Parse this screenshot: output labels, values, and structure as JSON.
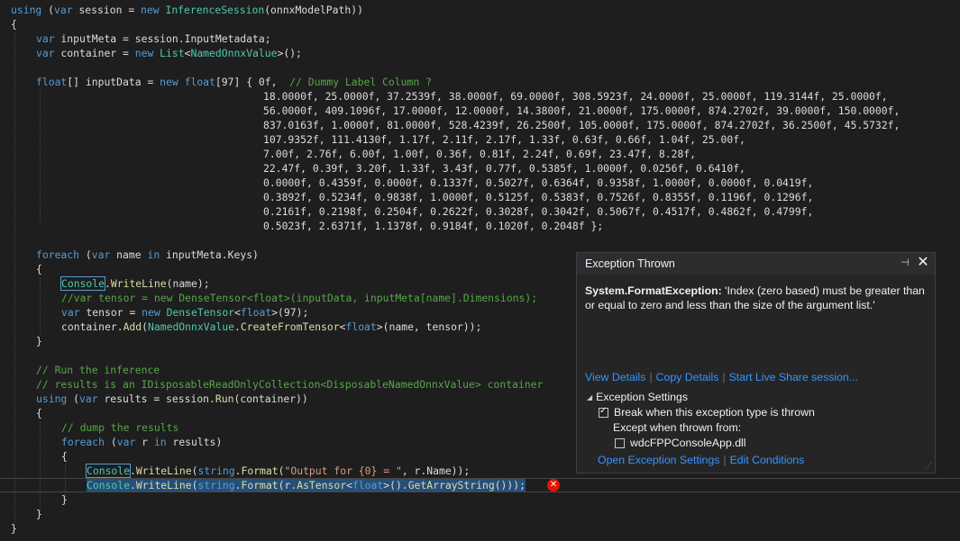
{
  "code": {
    "l1_kw": "using",
    "l1_a": " (",
    "l1_kw2": "var",
    "l1_b": " session = ",
    "l1_kw3": "new",
    "l1_ty": "InferenceSession",
    "l1_c": "(onnxModelPath))",
    "l2": "{",
    "l3_kw": "var",
    "l3_a": " inputMeta = session.InputMetadata;",
    "l4_kw": "var",
    "l4_a": " container = ",
    "l4_kw2": "new",
    "l4_ty": "List",
    "l4_b": "<",
    "l4_ty2": "NamedOnnxValue",
    "l4_c": ">();",
    "l5_kw": "float",
    "l5_a": "[] inputData = ",
    "l5_kw2": "new",
    "l5_kw3": "float",
    "l5_b": "[97] { 0f,  ",
    "l5_cm": "// Dummy Label Column ?",
    "data_lines": [
      "18.0000f, 25.0000f, 37.2539f, 38.0000f, 69.0000f, 308.5923f, 24.0000f, 25.0000f, 119.3144f, 25.0000f,",
      "56.0000f, 409.1096f, 17.0000f, 12.0000f, 14.3800f, 21.0000f, 175.0000f, 874.2702f, 39.0000f, 150.0000f,",
      "837.0163f, 1.0000f, 81.0000f, 528.4239f, 26.2500f, 105.0000f, 175.0000f, 874.2702f, 36.2500f, 45.5732f,",
      "107.9352f, 111.4130f, 1.17f, 2.11f, 2.17f, 1.33f, 0.63f, 0.66f, 1.04f, 25.00f,",
      "7.00f, 2.76f, 6.00f, 1.00f, 0.36f, 0.81f, 2.24f, 0.69f, 23.47f, 8.28f,",
      "22.47f, 0.39f, 3.20f, 1.33f, 3.43f, 0.77f, 0.5385f, 1.0000f, 0.0256f, 0.6410f,",
      "0.0000f, 0.4359f, 0.0000f, 0.1337f, 0.5027f, 0.6364f, 0.9358f, 1.0000f, 0.0000f, 0.0419f,",
      "0.3892f, 0.5234f, 0.9838f, 1.0000f, 0.5125f, 0.5383f, 0.7526f, 0.8355f, 0.1196f, 0.1296f,",
      "0.2161f, 0.2198f, 0.2504f, 0.2622f, 0.3028f, 0.3042f, 0.5067f, 0.4517f, 0.4862f, 0.4799f,",
      "0.5023f, 2.6371f, 1.1378f, 0.9184f, 0.1020f, 0.2048f };"
    ],
    "l17_kw": "foreach",
    "l17_a": " (",
    "l17_kw2": "var",
    "l17_b": " name ",
    "l17_kw3": "in",
    "l17_c": " inputMeta.Keys)",
    "l18": "{",
    "l19_ty": "Console",
    "l19_a": ".",
    "l19_fn": "WriteLine",
    "l19_b": "(name);",
    "l20_cm": "//var tensor = new DenseTensor<float>(inputData, inputMeta[name].Dimensions);",
    "l21_kw": "var",
    "l21_a": " tensor = ",
    "l21_kw2": "new",
    "l21_ty": "DenseTensor",
    "l21_b": "<",
    "l21_kw3": "float",
    "l21_c": ">(97);",
    "l22_a": "container.",
    "l22_fn": "Add",
    "l22_b": "(",
    "l22_ty": "NamedOnnxValue",
    "l22_c": ".",
    "l22_fn2": "CreateFromTensor",
    "l22_d": "<",
    "l22_kw": "float",
    "l22_e": ">(name, tensor));",
    "l23": "}",
    "l25_cm": "// Run the inference",
    "l26_cm": "// results is an IDisposableReadOnlyCollection<DisposableNamedOnnxValue> container",
    "l27_kw": "using",
    "l27_a": " (",
    "l27_kw2": "var",
    "l27_b": " results = session.",
    "l27_fn": "Run",
    "l27_c": "(container))",
    "l28": "{",
    "l29_cm": "// dump the results",
    "l30_kw": "foreach",
    "l30_a": " (",
    "l30_kw2": "var",
    "l30_b": " r ",
    "l30_kw3": "in",
    "l30_c": " results)",
    "l31": "{",
    "l32_ty": "Console",
    "l32_a": ".",
    "l32_fn": "WriteLine",
    "l32_b": "(",
    "l32_kw": "string",
    "l32_c": ".",
    "l32_fn2": "Format",
    "l32_d": "(",
    "l32_st": "\"Output for {0} = \"",
    "l32_e": ", r.Name));",
    "l33_ty": "Console",
    "l33_a": ".",
    "l33_fn": "WriteLine",
    "l33_b": "(",
    "l33_kw": "string",
    "l33_c": ".",
    "l33_fn2": "Format",
    "l33_d": "(r.",
    "l33_fn3": "AsTensor",
    "l33_e": "<",
    "l33_kw2": "float",
    "l33_f": ">().",
    "l33_fn4": "GetArrayString",
    "l33_g": "()));",
    "l34": "}",
    "l35": "}",
    "l36": "}"
  },
  "popup": {
    "title": "Exception Thrown",
    "exception_type": "System.FormatException:",
    "exception_message": " 'Index (zero based) must be greater than or equal to zero and less than the size of the argument list.'",
    "links": [
      "View Details",
      "Copy Details",
      "Start Live Share session..."
    ],
    "settings_title": "Exception Settings",
    "break_label": "Break when this exception type is thrown",
    "break_checked": true,
    "except_label": "Except when thrown from:",
    "module_label": "wdcFPPConsoleApp.dll",
    "module_checked": false,
    "bottom_links": [
      "Open Exception Settings",
      "Edit Conditions"
    ]
  },
  "icons": {
    "error": "error-circle-icon",
    "pin": "pin-icon",
    "close": "close-icon"
  },
  "colors": {
    "background": "#1e1e1e",
    "keyword": "#569cd6",
    "type": "#4ec9b0",
    "comment": "#57a64a",
    "string": "#d69d85",
    "method": "#dcdcaa",
    "link": "#3794ff",
    "error": "#e51400"
  }
}
